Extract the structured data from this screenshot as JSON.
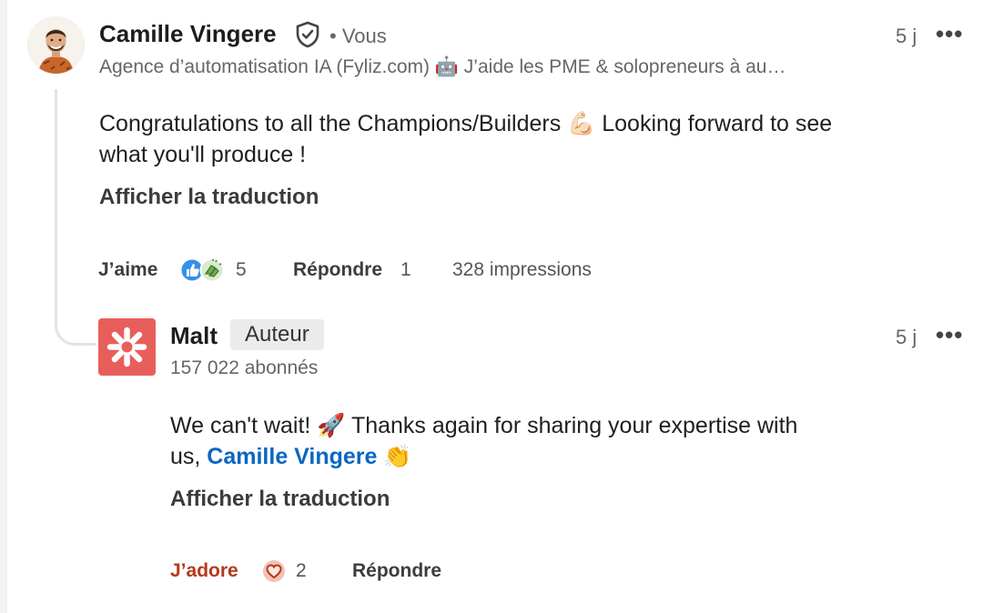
{
  "comment": {
    "author_name": "Camille Vingere",
    "you_label": "• Vous",
    "headline": "Agence d’automatisation IA (Fyliz.com) 🤖 J’aide les PME & solopreneurs à au…",
    "time": "5 j",
    "more": "•••",
    "text_line1": "Congratulations to all the Champions/Builders 💪🏻 Looking forward to see",
    "text_line2": "what you'll produce !",
    "translate": "Afficher la traduction",
    "like_label": "J’aime",
    "reaction_count": "5",
    "reply_label": "Répondre",
    "reply_count": "1",
    "impressions": "328 impressions"
  },
  "reply": {
    "author_name": "Malt",
    "author_badge": "Auteur",
    "followers": "157 022 abonnés",
    "time": "5 j",
    "more": "•••",
    "text_line1": "We can't wait! 🚀 Thanks again for sharing your expertise with",
    "text_prefix": "us, ",
    "mention": "Camille Vingere",
    "text_suffix": " 👏",
    "translate": "Afficher la traduction",
    "reaction_label": "J’adore",
    "reaction_count": "2",
    "reply_label": "Répondre"
  },
  "colors": {
    "malt_brand": "#e85e5a",
    "mention_blue": "#0a66c2",
    "adore_red": "#b33a1a",
    "like_blue": "#378fe9",
    "celebrate_green": "#44712e"
  },
  "icons": [
    "verified-shield-icon",
    "like-reaction-icon",
    "celebrate-reaction-icon",
    "love-reaction-icon",
    "more-options-icon"
  ]
}
